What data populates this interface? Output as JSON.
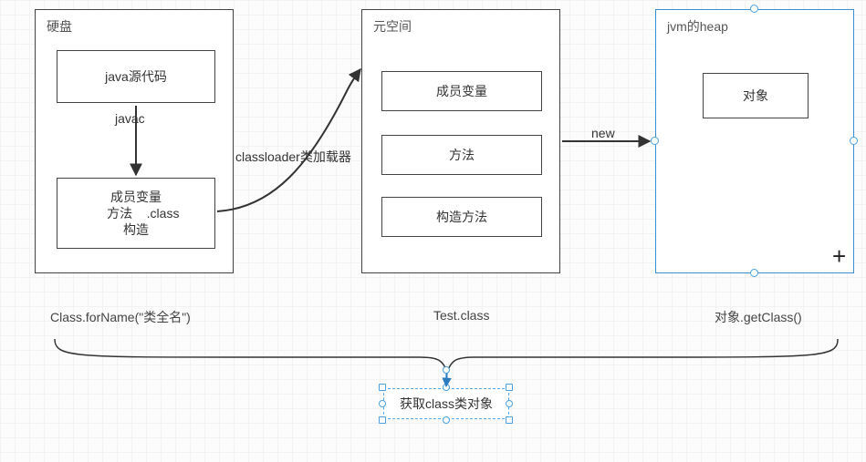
{
  "panels": {
    "disk": {
      "title": "硬盘"
    },
    "meta": {
      "title": "元空间"
    },
    "heap": {
      "title": "jvm的heap"
    }
  },
  "boxes": {
    "javaSource": "java源代码",
    "classFile": "成员变量\n    方法    .class\n构造",
    "memberVar": "成员变量",
    "method": "方法",
    "constructor": "构造方法",
    "object": "对象"
  },
  "labels": {
    "javac": "javac",
    "classloader": "classloader类加载器",
    "new": "new"
  },
  "captions": {
    "left": "Class.forName(\"类全名\")",
    "center": "Test.class",
    "right": "对象.getClass()"
  },
  "selected": {
    "label": "获取class类对象"
  }
}
